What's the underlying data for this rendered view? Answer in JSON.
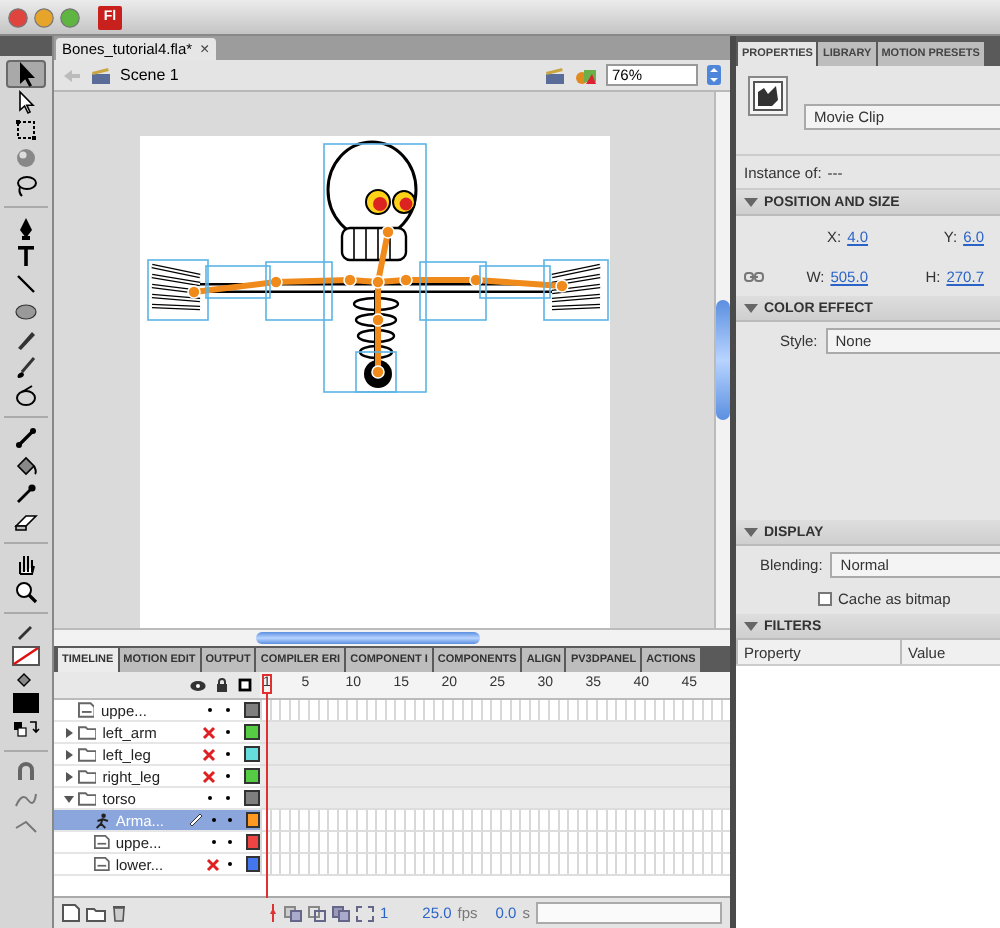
{
  "window": {
    "app_icon": "Fl"
  },
  "tool_groups": [
    [
      {
        "kind": "selection",
        "selected": true
      },
      {
        "kind": "subselection",
        "selected": false
      },
      {
        "kind": "transform",
        "selected": false
      },
      {
        "kind": "rotation",
        "selected": false
      },
      {
        "kind": "lasso",
        "selected": false
      }
    ],
    [
      {
        "kind": "pen",
        "selected": false
      },
      {
        "kind": "text",
        "selected": false
      },
      {
        "kind": "line",
        "selected": false
      },
      {
        "kind": "oval",
        "selected": false
      },
      {
        "kind": "pencil",
        "selected": false
      },
      {
        "kind": "brush",
        "selected": false
      },
      {
        "kind": "deco",
        "selected": false
      }
    ],
    [
      {
        "kind": "bone",
        "selected": false
      },
      {
        "kind": "paint-bucket",
        "selected": false
      },
      {
        "kind": "eyedropper",
        "selected": false
      },
      {
        "kind": "eraser",
        "selected": false
      }
    ],
    [
      {
        "kind": "hand",
        "selected": false
      },
      {
        "kind": "zoom",
        "selected": false
      }
    ],
    [
      {
        "kind": "stroke-color",
        "selected": false
      },
      {
        "kind": "fill-color",
        "selected": false
      },
      {
        "kind": "swap",
        "selected": false
      }
    ],
    [
      {
        "kind": "snap",
        "selected": false
      },
      {
        "kind": "smooth",
        "selected": false
      },
      {
        "kind": "straighten",
        "selected": false
      }
    ]
  ],
  "document": {
    "tab": "Bones_tutorial4.fla*",
    "close": "×",
    "scene": "Scene 1",
    "zoom": "76%"
  },
  "timeline": {
    "tabs": [
      {
        "label": "TIMELINE",
        "selected": true
      },
      {
        "label": "MOTION EDIT",
        "selected": false
      },
      {
        "label": "OUTPUT",
        "selected": false
      },
      {
        "label": "COMPILER ERI",
        "selected": false
      },
      {
        "label": "COMPONENT I",
        "selected": false
      },
      {
        "label": "COMPONENTS",
        "selected": false
      },
      {
        "label": "ALIGN",
        "selected": false
      },
      {
        "label": "PV3DPANEL",
        "selected": false
      },
      {
        "label": "ACTIONS",
        "selected": false
      }
    ],
    "frame_numbers": [
      "1",
      "5",
      "10",
      "15",
      "20",
      "25",
      "30",
      "35",
      "40",
      "45"
    ],
    "layers": [
      {
        "kind": "layer",
        "name": "uppe...",
        "hidden": false,
        "color": "#7f7f7f",
        "selected": false
      },
      {
        "kind": "folder",
        "name": "left_arm",
        "expanded": false,
        "hidden": true,
        "color": "#55cc44",
        "selected": false
      },
      {
        "kind": "folder",
        "name": "left_leg",
        "expanded": false,
        "hidden": true,
        "color": "#66dddd",
        "selected": false
      },
      {
        "kind": "folder",
        "name": "right_leg",
        "expanded": false,
        "hidden": true,
        "color": "#55cc44",
        "selected": false
      },
      {
        "kind": "folder",
        "name": "torso",
        "expanded": true,
        "hidden": false,
        "color": "#7f7f7f",
        "selected": false,
        "children": [
          {
            "kind": "armature",
            "name": "Arma...",
            "hidden": false,
            "color": "#ff9922",
            "selected": true
          },
          {
            "kind": "layer",
            "name": "uppe...",
            "hidden": false,
            "color": "#ee4444",
            "selected": false
          },
          {
            "kind": "layer",
            "name": "lower...",
            "hidden": true,
            "color": "#4477ee",
            "selected": false
          }
        ]
      }
    ],
    "current_frame": "1",
    "fps": "25.0",
    "fps_unit": "fps",
    "time": "0.0",
    "time_unit": "s"
  },
  "properties": {
    "tabs": [
      {
        "label": "PROPERTIES",
        "selected": true
      },
      {
        "label": "LIBRARY",
        "selected": false
      },
      {
        "label": "MOTION PRESETS",
        "selected": false
      }
    ],
    "type": "Movie Clip",
    "instance_label": "Instance of:",
    "instance_value": "---",
    "position_size": {
      "title": "POSITION AND SIZE",
      "expanded": true,
      "fields": [
        {
          "label": "X:",
          "value": "4.0"
        },
        {
          "label": "Y:",
          "value": "6.0"
        },
        {
          "label": "W:",
          "value": "505.0"
        },
        {
          "label": "H:",
          "value": "270.7"
        }
      ]
    },
    "color_effect": {
      "title": "COLOR EFFECT",
      "expanded": true,
      "style_label": "Style:",
      "style": "None"
    },
    "display": {
      "title": "DISPLAY",
      "expanded": true,
      "blending_label": "Blending:",
      "blending": "Normal",
      "cache_label": "Cache as bitmap",
      "cache_checked": false
    },
    "filters": {
      "title": "FILTERS",
      "expanded": true,
      "columns": [
        "Property",
        "Value"
      ]
    }
  }
}
